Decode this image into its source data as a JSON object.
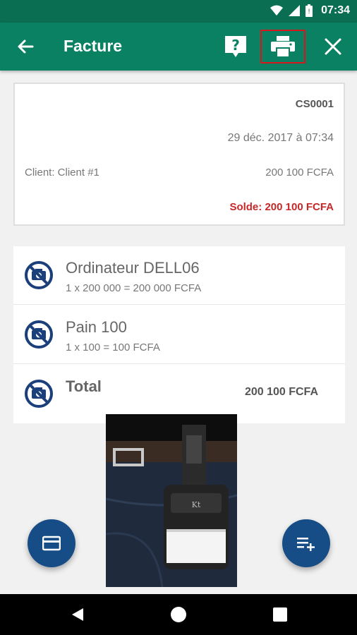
{
  "status_bar": {
    "time": "07:34"
  },
  "app_bar": {
    "title": "Facture"
  },
  "invoice": {
    "number": "CS0001",
    "date": "29 déc. 2017 à 07:34",
    "client": "Client: Client #1",
    "amount": "200 100 FCFA",
    "solde": "Solde: 200 100 FCFA"
  },
  "items": [
    {
      "name": "Ordinateur DELL06",
      "detail": "1 x 200 000 = 200 000 FCFA"
    },
    {
      "name": "Pain 100",
      "detail": "1 x 100 = 100 FCFA"
    }
  ],
  "total": {
    "label": "Total",
    "value": "200 100 FCFA"
  },
  "colors": {
    "toolbar": "#0b8163",
    "status": "#0a6e52",
    "accent_red": "#c62828",
    "fab": "#174d86",
    "highlight_box": "#d8161b"
  }
}
